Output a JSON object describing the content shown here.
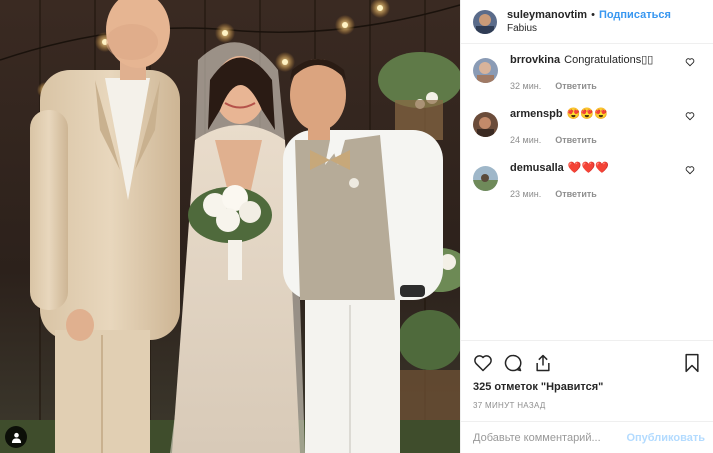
{
  "header": {
    "username": "suleymanovtim",
    "dot": "•",
    "follow_label": "Подписаться",
    "location": "Fabius"
  },
  "comments": [
    {
      "user": "brrovkina",
      "text": "Congratulations▯▯",
      "time": "32 мин.",
      "reply": "Ответить"
    },
    {
      "user": "armenspb",
      "text": "😍😍😍",
      "time": "24 мин.",
      "reply": "Ответить"
    },
    {
      "user": "demusalla",
      "text": "❤️❤️❤️",
      "time": "23 мин.",
      "reply": "Ответить"
    }
  ],
  "actions": {
    "likes": "325 отметок \"Нравится\"",
    "posted_ago": "37 МИНУТ НАЗАД"
  },
  "add_comment": {
    "placeholder": "Добавьте комментарий...",
    "publish_label": "Опубликовать"
  },
  "colors": {
    "link_blue": "#3897f0",
    "publish_disabled": "#b3dbff",
    "meta_gray": "#8e8e8e"
  },
  "icons": [
    "heart-icon",
    "comment-icon",
    "share-icon",
    "bookmark-icon",
    "user-tag-icon"
  ]
}
